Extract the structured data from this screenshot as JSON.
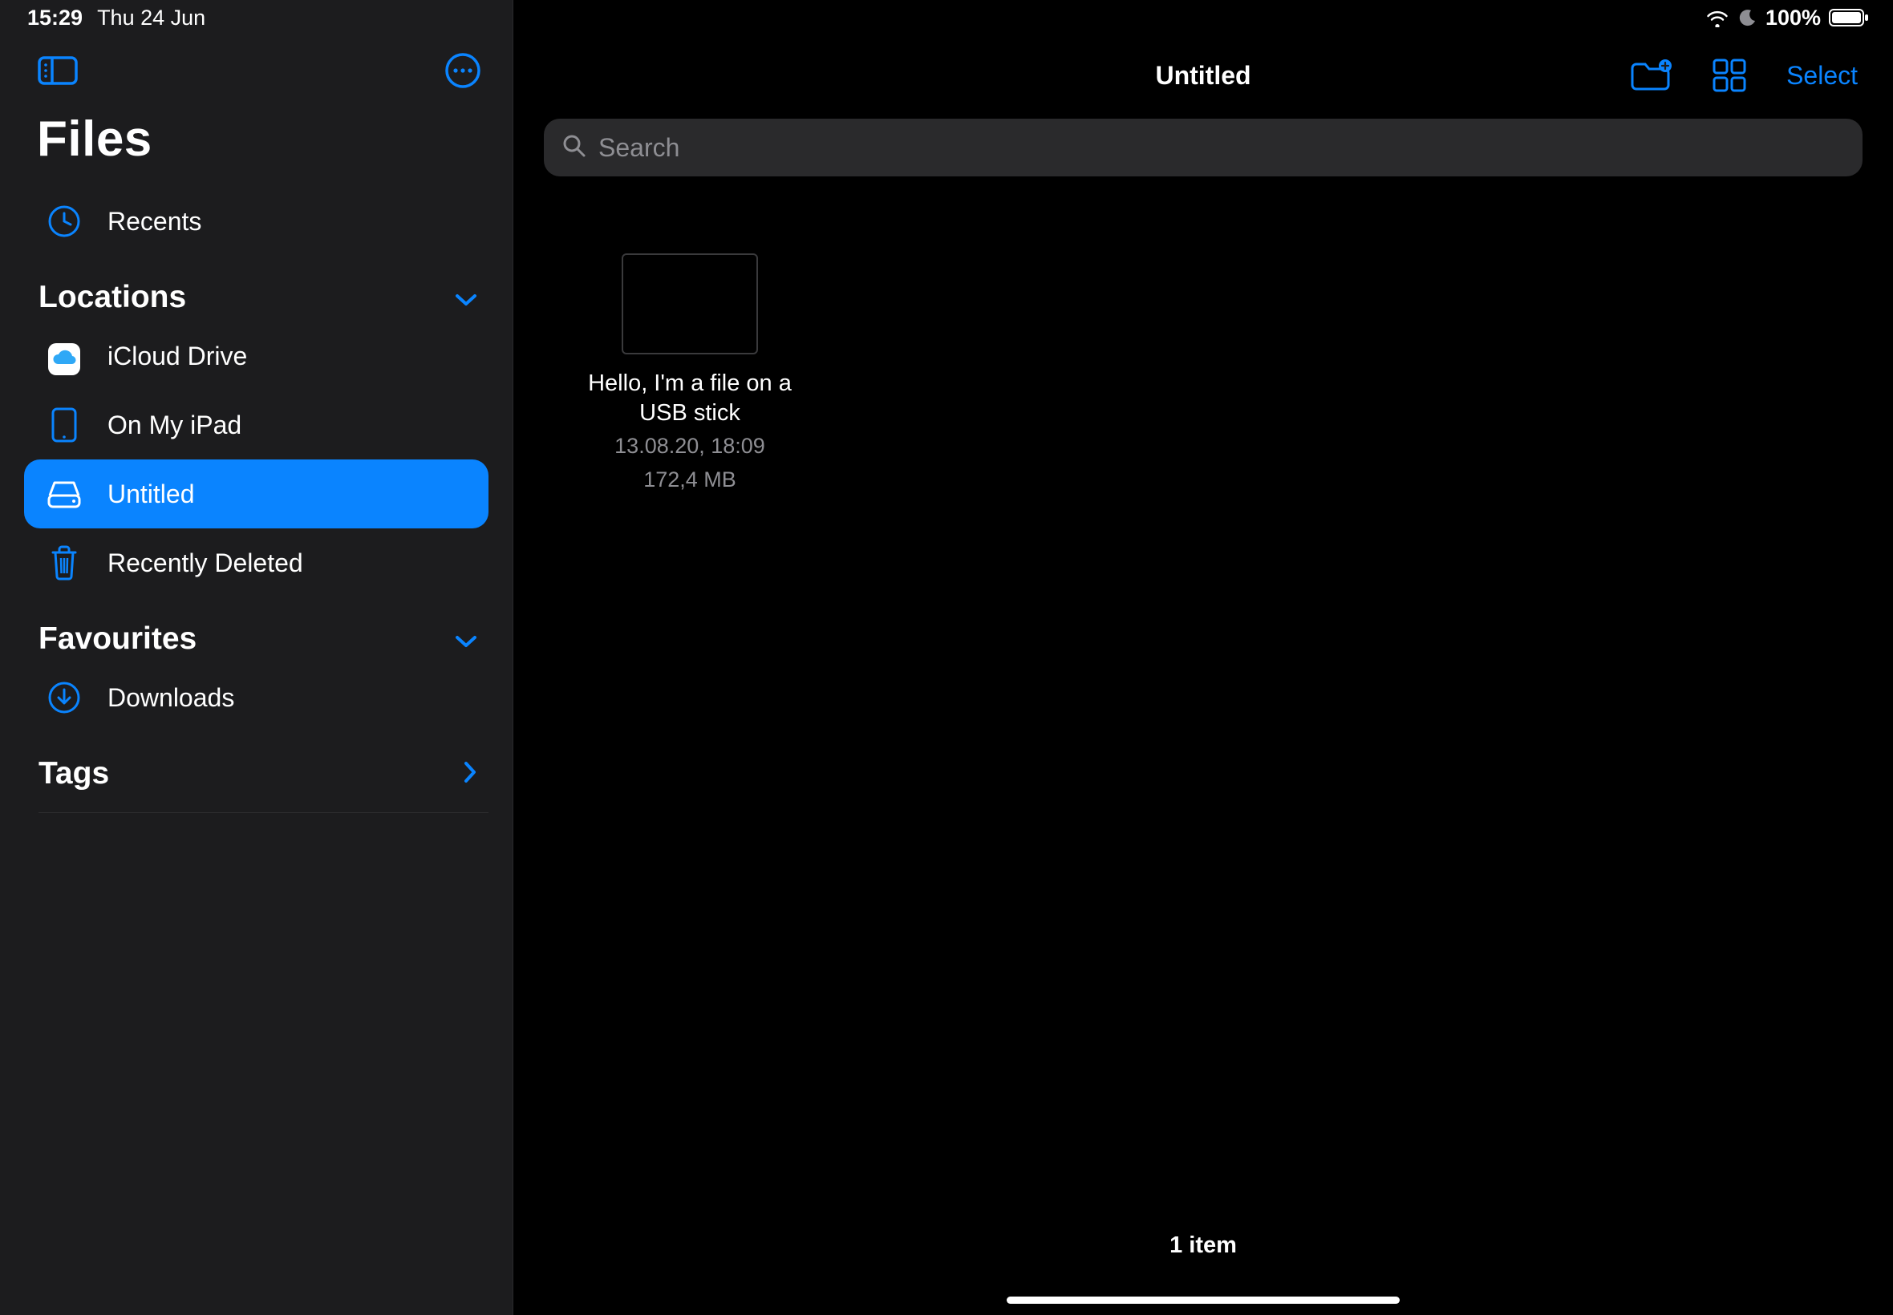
{
  "status": {
    "time": "15:29",
    "date": "Thu 24 Jun",
    "battery_pct": "100%"
  },
  "sidebar": {
    "app_title": "Files",
    "items": {
      "recents": "Recents",
      "icloud": "iCloud Drive",
      "on_my_ipad": "On My iPad",
      "untitled": "Untitled",
      "recently_deleted": "Recently Deleted",
      "downloads": "Downloads"
    },
    "sections": {
      "locations": "Locations",
      "favourites": "Favourites",
      "tags": "Tags"
    }
  },
  "header": {
    "title": "Untitled",
    "select_label": "Select"
  },
  "search": {
    "placeholder": "Search"
  },
  "files": [
    {
      "name": "Hello, I'm a file on a USB stick",
      "date": "13.08.20, 18:09",
      "size": "172,4 MB"
    }
  ],
  "footer": {
    "count_label": "1 item"
  }
}
